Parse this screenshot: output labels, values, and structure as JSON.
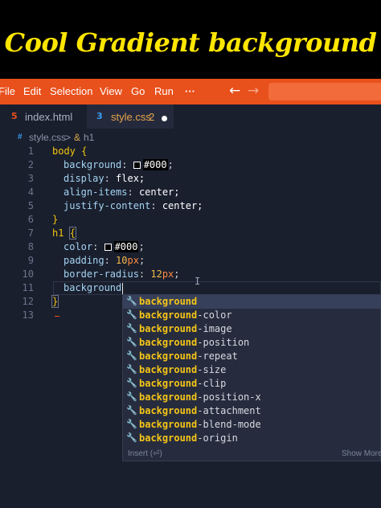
{
  "title": "Cool Gradient background",
  "menu": [
    "File",
    "Edit",
    "Selection",
    "View",
    "Go",
    "Run",
    "···"
  ],
  "colors": {
    "accent": "#e8501c",
    "editor_bg": "#1a1f2e",
    "title_text": "#ffe600",
    "selector": "#f1c40f"
  },
  "tabs": [
    {
      "icon": "html5-icon",
      "icon_glyph": "5",
      "label": "index.html",
      "active": false
    },
    {
      "icon": "css3-icon",
      "icon_glyph": "3",
      "label": "style.css",
      "badge": "2",
      "active": true,
      "dirty": true
    }
  ],
  "breadcrumb": {
    "file": "style.css",
    "sep": ">",
    "symbol_glyph": "&",
    "symbol": "h1"
  },
  "code": {
    "line_numbers": [
      "1",
      "2",
      "3",
      "4",
      "5",
      "6",
      "7",
      "8",
      "9",
      "10",
      "11",
      "12",
      "13"
    ],
    "l1_sel": "body",
    "l1_brace": "{",
    "l2_prop": "background",
    "l2_hex": "#000",
    "l2_end": ";",
    "l3_prop": "display",
    "l3_val": "flex;",
    "l4_prop": "align-items",
    "l4_val": "center;",
    "l5_prop": "justify-content",
    "l5_val": "center;",
    "l6_brace": "}",
    "l7_sel": "h1",
    "l7_brace": "{",
    "l8_prop": "color",
    "l8_hex": "#000",
    "l8_end": ";",
    "l9_prop": "padding",
    "l9_num": "10",
    "l9_unit": "px",
    "l9_end": ";",
    "l10_prop": "border-radius",
    "l10_num": "12",
    "l10_unit": "px",
    "l10_end": ";",
    "l11_typed": "background",
    "l12_brace": "}"
  },
  "suggestions": {
    "match": "background",
    "items": [
      "",
      "-color",
      "-image",
      "-position",
      "-repeat",
      "-size",
      "-clip",
      "-position-x",
      "-attachment",
      "-blend-mode",
      "-origin"
    ],
    "selected_index": 0,
    "footer_left": "Insert (⏎)",
    "footer_right": "Show More"
  }
}
